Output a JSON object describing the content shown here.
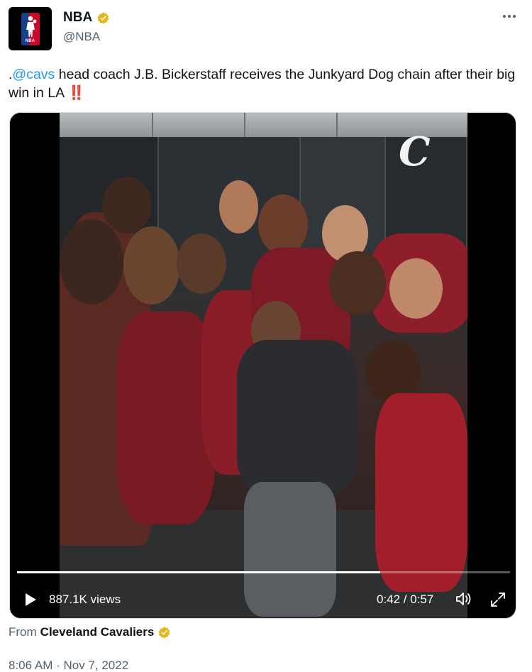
{
  "author": {
    "name": "NBA",
    "handle": "@NBA",
    "verified_icon": "gold-verified-badge",
    "logo_text": "NBA"
  },
  "tweet": {
    "prefix": ".",
    "mention": "@cavs",
    "text": " head coach J.B. Bickerstaff receives the Junkyard Dog chain after their big win in LA ",
    "emoji": "‼️"
  },
  "video": {
    "views": "887.1K views",
    "time": "0:42 / 0:57",
    "progress": 0.737,
    "watermark": "C"
  },
  "source": {
    "from_label": "From",
    "account": "Cleveland Cavaliers"
  },
  "timestamp": "8:06 AM · Nov 7, 2022",
  "colors": {
    "accent": "#1d9bf0",
    "verified_gold": "#e2b719",
    "cavs_wine": "#860038"
  }
}
